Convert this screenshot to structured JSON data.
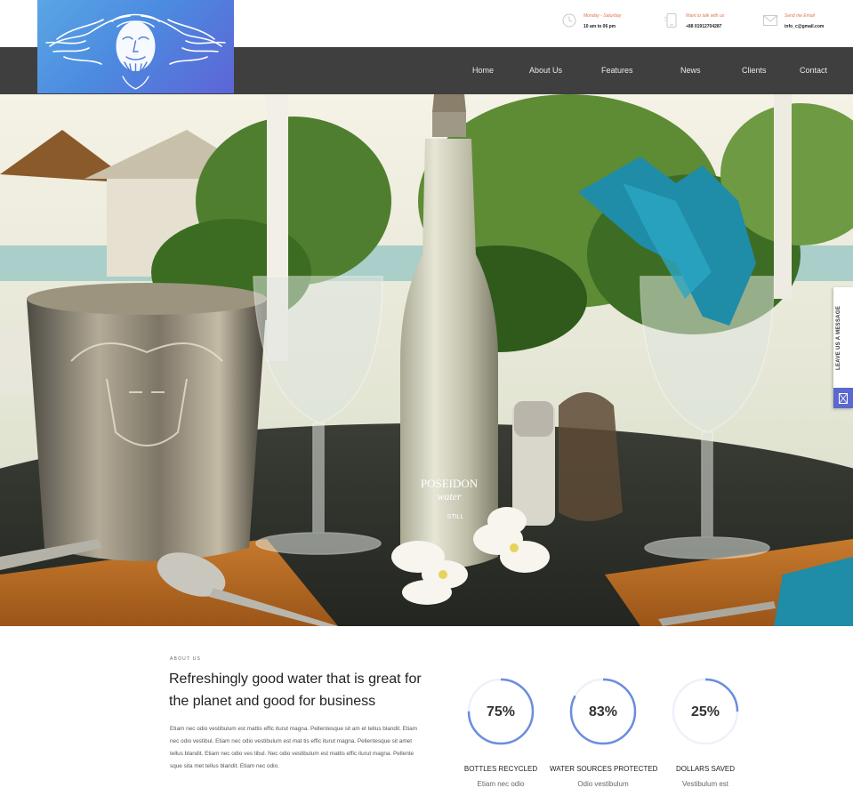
{
  "topbar": {
    "hours": {
      "label": "Monday - Saturday",
      "value": "10 am to 06 pm",
      "icon": "clock-icon"
    },
    "phone": {
      "label": "Want to talk with us",
      "value": "+88 01912704287",
      "icon": "phone-icon"
    },
    "email": {
      "label": "Send me Email",
      "value": "info_c@gmail.com",
      "icon": "envelope-icon"
    }
  },
  "nav": {
    "items": [
      {
        "label": "Home"
      },
      {
        "label": "About Us"
      },
      {
        "label": "Features"
      },
      {
        "label": "News"
      },
      {
        "label": "Clients"
      },
      {
        "label": "Contact"
      }
    ]
  },
  "hero": {
    "bottle_brand": "POSEIDON",
    "bottle_sub": "water",
    "bottle_type": "STILL"
  },
  "side_tab": {
    "label": "LEAVE US A MESSAGE",
    "icon": "envelope-icon"
  },
  "about": {
    "kicker": "ABOUT US",
    "title": "Refreshingly good water that is great for the planet and good for business",
    "body": "Etiam nec odio vestibulum est mattis effic iturut magna. Pellentesque sit am et tellus blandit. Etiam nec odio vestibul. Etiam nec odio vestibulum est mat tis effic iturut magna. Pellentesque sit amet tellus blandit. Etiam nec odio ves tibul.  Nec odio vestibulum est mattis effic iturut magna. Pellente sque sita met tellus blandit. Etiam nec odio."
  },
  "stats": [
    {
      "percent": "75%",
      "value": 75,
      "label": "BOTTLES RECYCLED",
      "sub": "Etiam nec odio"
    },
    {
      "percent": "83%",
      "value": 83,
      "label": "WATER SOURCES PROTECTED",
      "sub": "Odio vestibulum"
    },
    {
      "percent": "25%",
      "value": 25,
      "label": "DOLLARS SAVED",
      "sub": "Vestibulum est"
    }
  ],
  "colors": {
    "accent_orange": "#e2744c",
    "nav_bg": "#3f3f3f",
    "ring": "#6a8de0",
    "side_icon_bg": "#5b68cf"
  }
}
